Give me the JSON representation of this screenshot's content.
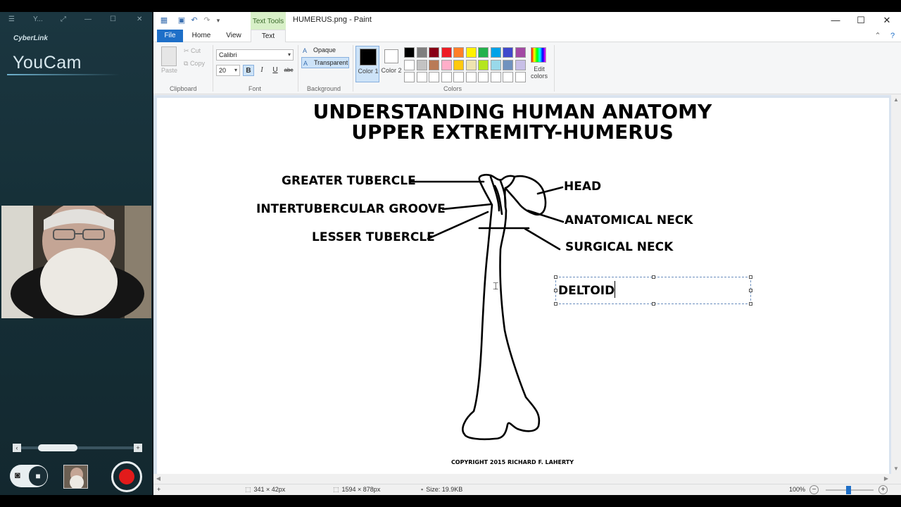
{
  "youcam": {
    "window_title": "Y...",
    "brand": "CyberLink",
    "product": "YouCam",
    "icons": {
      "menu": "menu-icon",
      "expand": "expand-icon",
      "minimize": "minimize-icon",
      "maximize": "maximize-icon",
      "close": "close-icon",
      "snapshot": "camera-icon",
      "video": "video-camera-icon",
      "record": "record-icon"
    }
  },
  "paint": {
    "title": "HUMERUS.png - Paint",
    "contextual_tab": "Text Tools",
    "tabs": [
      "File",
      "Home",
      "View",
      "Text"
    ],
    "clipboard": {
      "paste": "Paste",
      "cut": "Cut",
      "copy": "Copy",
      "group": "Clipboard"
    },
    "font": {
      "family": "Calibri",
      "size": "20",
      "bold": "B",
      "italic": "I",
      "underline": "U",
      "strike": "abc",
      "group": "Font"
    },
    "background": {
      "opaque": "Opaque",
      "transparent": "Transparent",
      "group": "Background"
    },
    "colors": {
      "color1": "Color 1",
      "color2": "Color 2",
      "edit": "Edit colors",
      "group": "Colors",
      "palette": [
        "#000000",
        "#7f7f7f",
        "#880015",
        "#ed1c24",
        "#ff7f27",
        "#fff200",
        "#22b14c",
        "#00a2e8",
        "#3f48cc",
        "#a349a4",
        "#ffffff",
        "#c3c3c3",
        "#b97a57",
        "#ffaec9",
        "#ffc90e",
        "#efe4b0",
        "#b5e61d",
        "#99d9ea",
        "#7092be",
        "#c8bfe7",
        "#ffffff",
        "#ffffff",
        "#ffffff",
        "#ffffff",
        "#ffffff",
        "#ffffff",
        "#ffffff",
        "#ffffff",
        "#ffffff",
        "#ffffff"
      ]
    },
    "canvas": {
      "title_line1": "UNDERSTANDING HUMAN ANATOMY",
      "title_line2": "UPPER EXTREMITY-HUMERUS",
      "labels": {
        "greater_tubercle": "GREATER TUBERCLE",
        "intertubercular_groove": "INTERTUBERCULAR GROOVE",
        "lesser_tubercle": "LESSER TUBERCLE",
        "head": "HEAD",
        "anatomical_neck": "ANATOMICAL NECK",
        "surgical_neck": "SURGICAL NECK"
      },
      "textbox_text": "DELTOID",
      "copyright": "COPYRIGHT 2015 RICHARD F. LAHERTY"
    },
    "status": {
      "selection_size": "341 × 42px",
      "image_size": "1594 × 878px",
      "file_size": "Size: 19.9KB",
      "zoom": "100%"
    }
  }
}
